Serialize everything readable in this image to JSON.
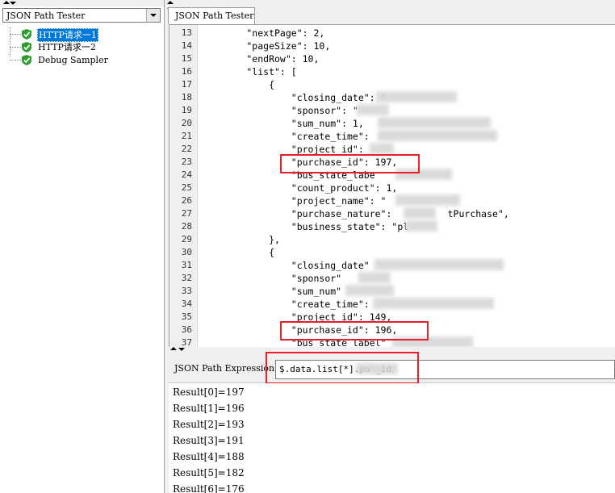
{
  "sidebar": {
    "selector_value": "JSON Path Tester",
    "tree_items": [
      {
        "label": "HTTP请求一1",
        "selected": true
      },
      {
        "label": "HTTP请求一2",
        "selected": false
      },
      {
        "label": "Debug Sampler",
        "selected": false
      }
    ]
  },
  "tab": {
    "label": "JSON Path Tester"
  },
  "code_lines": [
    {
      "n": "13",
      "text": "        \"nextPage\": 2,"
    },
    {
      "n": "14",
      "text": "        \"pageSize\": 10,"
    },
    {
      "n": "15",
      "text": "        \"endRow\": 10,"
    },
    {
      "n": "16",
      "text": "        \"list\": ["
    },
    {
      "n": "17",
      "text": "            {"
    },
    {
      "n": "18",
      "text": "                \"closing_date\": \""
    },
    {
      "n": "19",
      "text": "                \"sponsor\": \""
    },
    {
      "n": "20",
      "text": "                \"sum_num\": 1,"
    },
    {
      "n": "21",
      "text": "                \"create_time\":"
    },
    {
      "n": "22",
      "text": "                \"project_id\":"
    },
    {
      "n": "23",
      "text": "                \"purchase_id\": 197,"
    },
    {
      "n": "24",
      "text": "                \"bus_state_labe"
    },
    {
      "n": "25",
      "text": "                \"count_product\": 1,"
    },
    {
      "n": "26",
      "text": "                \"project_name\": \""
    },
    {
      "n": "27",
      "text": "                \"purchase_nature\":          tPurchase\","
    },
    {
      "n": "28",
      "text": "                \"business_state\": \"pl"
    },
    {
      "n": "29",
      "text": "            },"
    },
    {
      "n": "30",
      "text": "            {"
    },
    {
      "n": "31",
      "text": "                \"closing_date\""
    },
    {
      "n": "32",
      "text": "                \"sponsor\""
    },
    {
      "n": "33",
      "text": "                \"sum_num\""
    },
    {
      "n": "34",
      "text": "                \"create_time\":"
    },
    {
      "n": "35",
      "text": "                \"project_id\": 149,"
    },
    {
      "n": "36",
      "text": "                \"purchase_id\": 196,"
    },
    {
      "n": "37",
      "text": "                \"bus_state_label\""
    }
  ],
  "expression": {
    "label": "JSON Path Expression",
    "value": "$.data.list[*].pu         _id"
  },
  "results": [
    "Result[0]=197",
    "Result[1]=196",
    "Result[2]=193",
    "Result[3]=191",
    "Result[4]=188",
    "Result[5]=182",
    "Result[6]=176"
  ],
  "colors": {
    "highlight_box": "#e8202a",
    "selection": "#0078d7",
    "check_icon": "#2e9e2e"
  }
}
